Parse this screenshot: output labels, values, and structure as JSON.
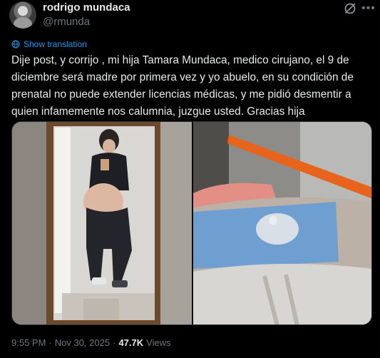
{
  "author": {
    "name": "rodrigo mundaca",
    "handle": "@rmunda"
  },
  "actions": {
    "grok_icon": "grok-icon",
    "more_icon": "more-icon"
  },
  "translate": {
    "label": "Show translation",
    "icon": "globe-icon"
  },
  "post": {
    "text": "Dije post, y corrijo , mi hija Tamara Mundaca, medico cirujano, el 9 de diciembre será madre por primera vez y yo abuelo, en su condición de prenatal no puede extender licencias médicas, y me pidió desmentir a quien infamemente nos calumnia, juzgue usted. Gracias hija"
  },
  "footer": {
    "time": "9:55 PM",
    "separator": "·",
    "date": "Nov 30, 2025",
    "views_count": "47.7K",
    "views_label": "Views"
  },
  "colors": {
    "background": "#000000",
    "text": "#e7e9ea",
    "secondary": "#71767b",
    "link": "#1d9bf0"
  }
}
